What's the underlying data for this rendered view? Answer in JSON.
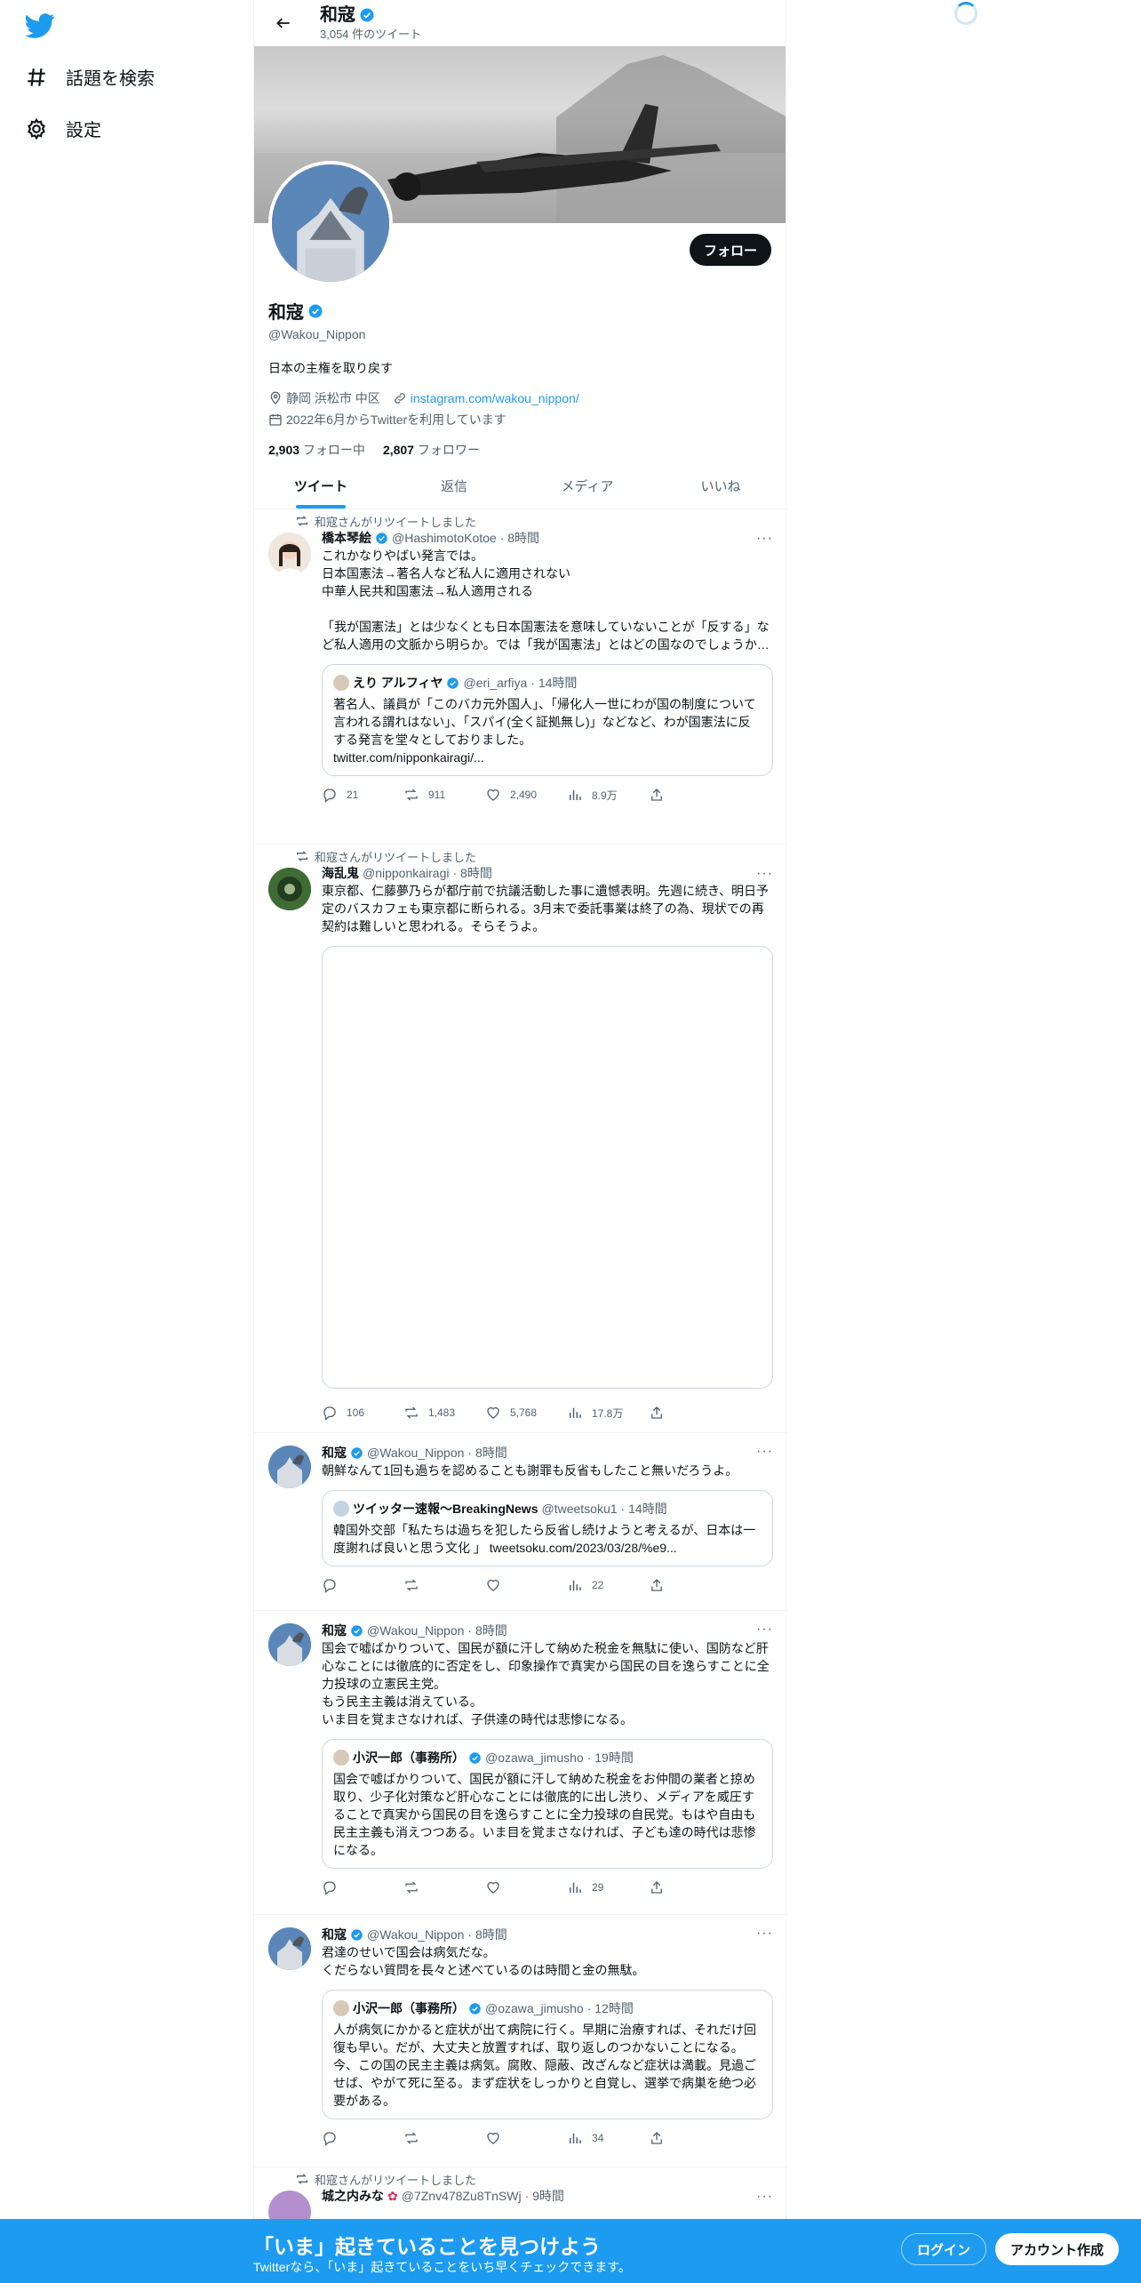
{
  "nav": {
    "explore_label": "話題を検索",
    "settings_label": "設定"
  },
  "header": {
    "title": "和寇",
    "tweet_count": "3,054 件のツイート"
  },
  "profile": {
    "follow_button": "フォロー",
    "name": "和寇",
    "handle": "@Wakou_Nippon",
    "bio": "日本の主権を取り戻す",
    "location": "静岡 浜松市 中区",
    "link": "instagram.com/wakou_nippon/",
    "joined": "2022年6月からTwitterを利用しています",
    "following_count": "2,903",
    "following_label": "フォロー中",
    "followers_count": "2,807",
    "followers_label": "フォロワー"
  },
  "tabs": [
    "ツイート",
    "返信",
    "メディア",
    "いいね"
  ],
  "tweets": [
    {
      "retweeted_by": "和寇さんがリツイートしました",
      "name": "橋本琴絵",
      "handle": "@HashimotoKotoe",
      "time": "· 8時間",
      "text": "これかなりやばい発言では。\n日本国憲法→著名人など私人に適用されない\n中華人民共和国憲法→私人適用される\n\n「我が国憲法」とは少なくとも日本国憲法を意味していないことが「反する」など私人適用の文脈から明らか。では「我が国憲法」とはどの国なのでしょうか…",
      "quote": {
        "name": "えり アルフィヤ",
        "handle": "@eri_arfiya",
        "time": "· 14時間",
        "text": "著名人、議員が「このバカ元外国人」、「帰化人一世にわが国の制度について言われる謂れはない」、「スパイ(全く証拠無し)」などなど、わが国憲法に反する発言を堂々としておりました。\ntwitter.com/nipponkairagi/..."
      },
      "replies": "21",
      "retweets": "911",
      "likes": "2,490",
      "views": "8.9万"
    },
    {
      "retweeted_by": "和寇さんがリツイートしました",
      "name": "海乱鬼",
      "handle": "@nipponkairagi",
      "time": "· 8時間",
      "text": "東京都、仁藤夢乃らが都庁前で抗議活動した事に遺憾表明。先週に続き、明日予定のバスカフェも東京都に断られる。3月末で委託事業は終了の為、現状での再契約は難しいと思われる。そらそうよ。",
      "replies": "106",
      "retweets": "1,483",
      "likes": "5,768",
      "views": "17.8万"
    },
    {
      "name": "和寇",
      "handle": "@Wakou_Nippon",
      "time": "· 8時間",
      "text": "朝鮮なんて1回も過ちを認めることも謝罪も反省もしたこと無いだろうよ。",
      "quote": {
        "name": "ツイッター速報〜BreakingNews",
        "handle": "@tweetsoku1",
        "time": "· 14時間",
        "text": "韓国外交部「私たちは過ちを犯したら反省し続けようと考えるが、日本は一度謝れば良いと思う文化 」 tweetsoku.com/2023/03/28/%e9..."
      },
      "replies": "",
      "retweets": "",
      "likes": "",
      "views": "22"
    },
    {
      "name": "和寇",
      "handle": "@Wakou_Nippon",
      "time": "· 8時間",
      "text": "国会で嘘ばかりついて、国民が額に汗して納めた税金を無駄に使い、国防など肝心なことには徹底的に否定をし、印象操作で真実から国民の目を逸らすことに全力投球の立憲民主党。\nもう民主主義は消えている。\nいま目を覚まさなければ、子供達の時代は悲惨になる。",
      "quote": {
        "name": "小沢一郎（事務所）",
        "handle": "@ozawa_jimusho",
        "time": "· 19時間",
        "text": "国会で嘘ばかりついて、国民が額に汗して納めた税金をお仲間の業者と掠め取り、少子化対策など肝心なことには徹底的に出し渋り、メディアを威圧することで真実から国民の目を逸らすことに全力投球の自民党。もはや自由も民主主義も消えつつある。いま目を覚まさなければ、子ども達の時代は悲惨になる。"
      },
      "replies": "",
      "retweets": "",
      "likes": "",
      "views": "29"
    },
    {
      "name": "和寇",
      "handle": "@Wakou_Nippon",
      "time": "· 8時間",
      "text": "君達のせいで国会は病気だな。\nくだらない質問を長々と述べているのは時間と金の無駄。",
      "quote": {
        "name": "小沢一郎（事務所）",
        "handle": "@ozawa_jimusho",
        "time": "· 12時間",
        "text": "人が病気にかかると症状が出て病院に行く。早期に治療すれば、それだけ回復も早い。だが、大丈夫と放置すれば、取り返しのつかないことになる。今、この国の民主主義は病気。腐敗、隠蔽、改ざんなど症状は満載。見過ごせば、やがて死に至る。まず症状をしっかりと自覚し、選挙で病巣を絶つ必要がある。"
      },
      "replies": "",
      "retweets": "",
      "likes": "",
      "views": "34"
    },
    {
      "retweeted_by": "和寇さんがリツイートしました",
      "name": "城之内みな",
      "handle": "@7Znv478Zu8TnSWj",
      "time": "· 9時間"
    }
  ],
  "bottom_bar": {
    "title": "「いま」起きていることを見つけよう",
    "subtitle": "Twitterなら、「いま」起きていることをいち早くチェックできます。",
    "login": "ログイン",
    "signup": "アカウント作成"
  },
  "colors": {
    "accent": "#1d9bf0",
    "text": "#0f1419",
    "muted": "#536471"
  }
}
